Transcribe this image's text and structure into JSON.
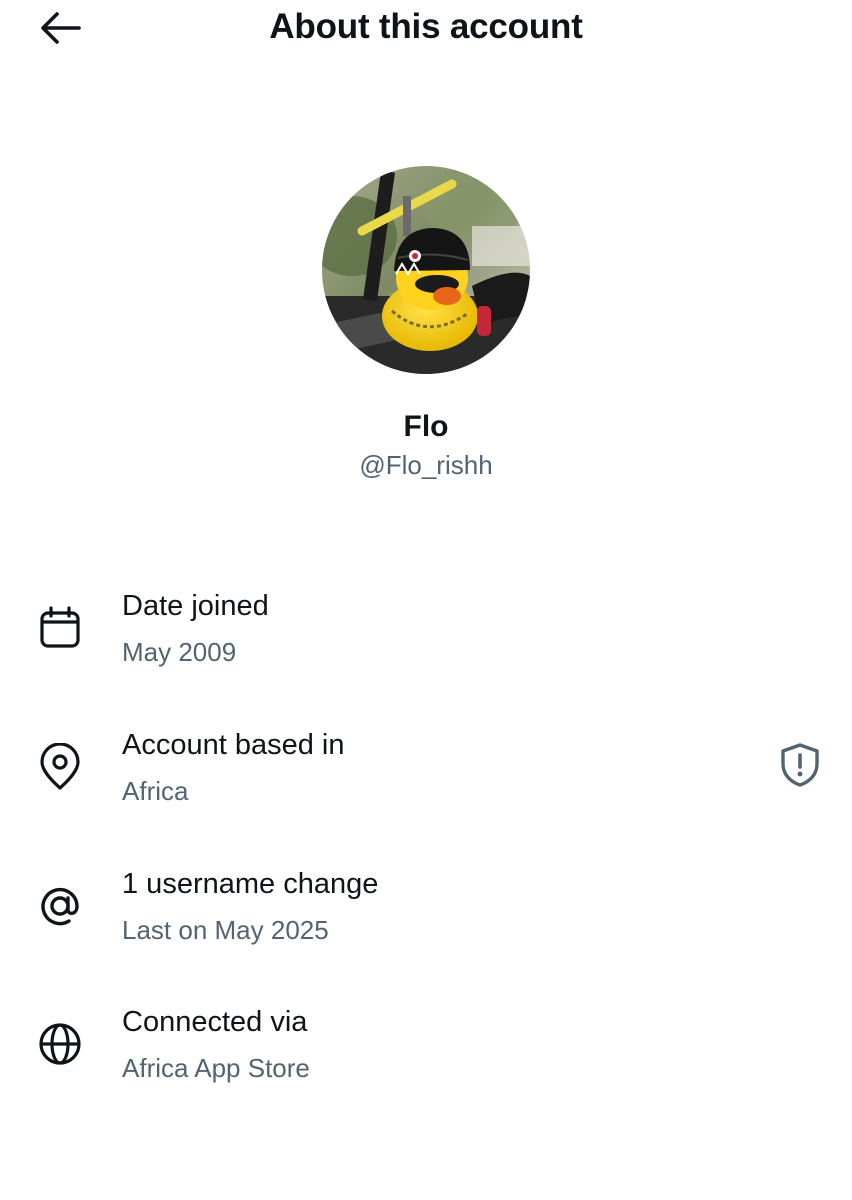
{
  "header": {
    "title": "About this account",
    "back_icon": "arrow-left-icon"
  },
  "profile": {
    "display_name": "Flo",
    "handle": "@Flo_rishh",
    "avatar_description_icon": "avatar-photo"
  },
  "info": [
    {
      "icon": "calendar-icon",
      "title": "Date joined",
      "subtitle": "May 2009"
    },
    {
      "icon": "location-pin-icon",
      "title": "Account based in",
      "subtitle": "Africa",
      "trailing_icon": "shield-alert-icon"
    },
    {
      "icon": "at-sign-icon",
      "title": "1 username change",
      "subtitle": "Last on May 2025"
    },
    {
      "icon": "globe-icon",
      "title": "Connected via",
      "subtitle": "Africa App Store"
    }
  ],
  "colors": {
    "text_primary": "#0f1419",
    "text_secondary": "#536471",
    "background": "#ffffff"
  }
}
